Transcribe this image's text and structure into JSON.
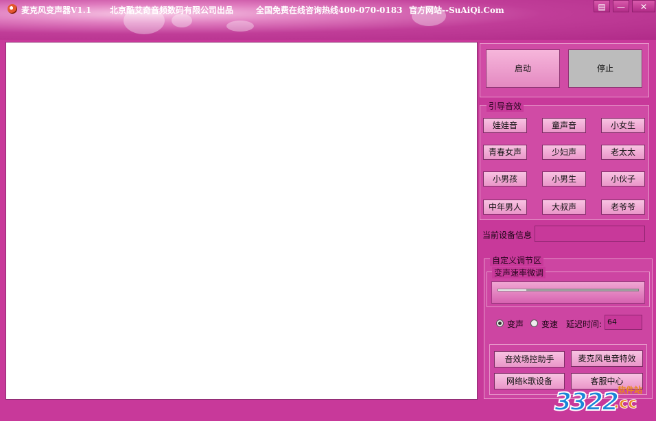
{
  "window": {
    "app_title": "麦克风变声器V1.1",
    "company_text": "北京酷艾奇音频数码有限公司出品",
    "hotline_text": "全国免费在线咨询热线400-070-0183",
    "website_text": "官方网站--SuAiQi.Com",
    "controls": {
      "menu": "▤",
      "minimize": "—",
      "close": "✕"
    }
  },
  "control_panel": {
    "start_label": "启动",
    "stop_label": "停止"
  },
  "guide_effects": {
    "title": "引导音效",
    "buttons": [
      "娃娃音",
      "童声音",
      "小女生",
      "青春女声",
      "少妇声",
      "老太太",
      "小男孩",
      "小男生",
      "小伙子",
      "中年男人",
      "大叔声",
      "老爷爷"
    ]
  },
  "device_info": {
    "label": "当前设备信息",
    "value": ""
  },
  "custom_adjust": {
    "title": "自定义调节区",
    "slider_group_title": "变声速率微调",
    "slider_level": 0.2,
    "radio_voice_label": "变声",
    "radio_speed_label": "变速",
    "radio_selected": "voice",
    "delay_label": "延迟时间:",
    "delay_value": "64"
  },
  "tools": {
    "effect_assistant": "音效场控助手",
    "mic_effects": "麦克风电音特效",
    "karaoke_device": "网络k歌设备",
    "customer_center": "客服中心"
  },
  "watermark": {
    "number": "3322",
    "suffix": ".cc",
    "site": "软件站"
  },
  "colors": {
    "background": "#c8399a",
    "button_pink": "#f0a7d3",
    "stop_grey": "#bcbcbc"
  }
}
